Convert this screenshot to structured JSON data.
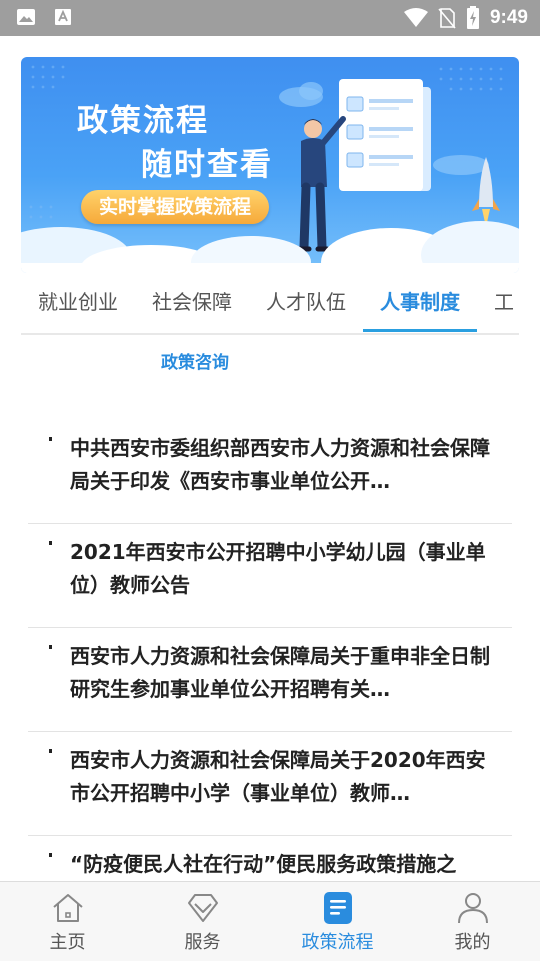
{
  "status_bar": {
    "time": "9:49",
    "icons": [
      "image-icon",
      "text-a-icon",
      "wifi-icon",
      "no-sim-icon",
      "battery-charging-icon"
    ]
  },
  "banner": {
    "title_line1": "政策流程",
    "title_line2": "随时查看",
    "pill_text": "实时掌握政策流程",
    "colors": {
      "background": "#4aa2f6",
      "pill": "#f6a93a"
    }
  },
  "tabs": [
    {
      "label": "就业创业",
      "active": false
    },
    {
      "label": "社会保障",
      "active": false
    },
    {
      "label": "人才队伍",
      "active": false
    },
    {
      "label": "人事制度",
      "active": true
    },
    {
      "label": "工",
      "active": false
    }
  ],
  "subtab": {
    "label": "政策咨询"
  },
  "articles": [
    {
      "title": "中共西安市委组织部西安市人力资源和社会保障局关于印发《西安市事业单位公开…"
    },
    {
      "title": "2021年西安市公开招聘中小学幼儿园（事业单位）教师公告"
    },
    {
      "title": "西安市人力资源和社会保障局关于重申非全日制研究生参加事业单位公开招聘有关…"
    },
    {
      "title": "西安市人力资源和社会保障局关于2020年西安市公开招聘中小学（事业单位）教师…"
    },
    {
      "title": "“防疫便民人社在行动”便民服务政策措施之"
    }
  ],
  "bottom_nav": [
    {
      "label": "主页",
      "icon": "home-icon",
      "active": false
    },
    {
      "label": "服务",
      "icon": "diamond-icon",
      "active": false
    },
    {
      "label": "政策流程",
      "icon": "document-icon",
      "active": true
    },
    {
      "label": "我的",
      "icon": "person-icon",
      "active": false
    }
  ],
  "colors": {
    "accent": "#2a8cde",
    "status_bar": "#9e9e9e"
  }
}
